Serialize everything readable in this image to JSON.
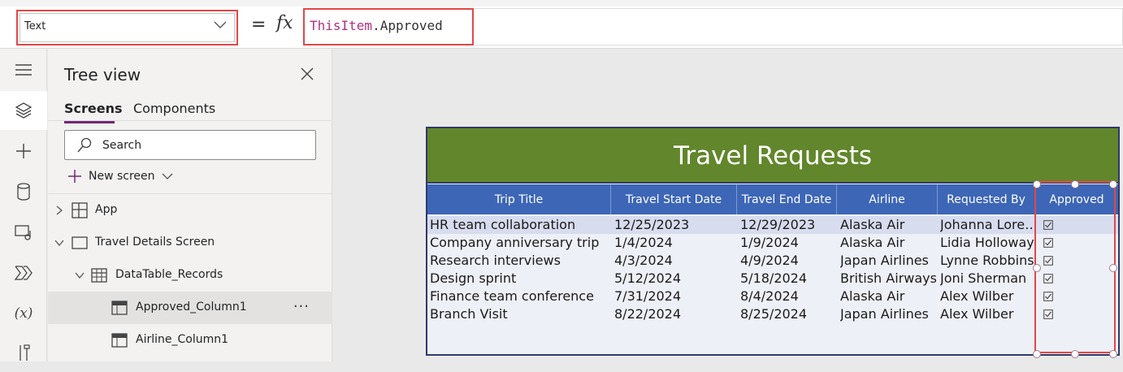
{
  "formula_bar": {
    "property": "Text",
    "equals": "=",
    "fx": "fx",
    "formula_keyword": "ThisItem",
    "formula_rest": ".Approved"
  },
  "rail": {
    "icons": [
      "hamburger-menu-icon",
      "layers-icon",
      "plus-icon",
      "database-icon",
      "media-icon",
      "power-automate-icon",
      "variables-icon",
      "tools-icon"
    ],
    "variables_label": "(x)"
  },
  "tree_view": {
    "title": "Tree view",
    "tabs": [
      "Screens",
      "Components"
    ],
    "search_placeholder": "Search",
    "new_screen_label": "New screen",
    "nodes": [
      {
        "label": "App"
      },
      {
        "label": "Travel Details Screen"
      },
      {
        "label": "DataTable_Records"
      },
      {
        "label": "Approved_Column1",
        "more": "···"
      },
      {
        "label": "Airline_Column1"
      }
    ]
  },
  "canvas": {
    "title": "Travel Requests",
    "columns": [
      "Trip Title",
      "Travel Start Date",
      "Travel End Date",
      "Airline",
      "Requested By",
      "Approved"
    ],
    "rows": [
      [
        "HR team collaboration",
        "12/25/2023",
        "12/29/2023",
        "Alaska Air",
        "Johanna Lore…"
      ],
      [
        "Company anniversary trip",
        "1/4/2024",
        "1/9/2024",
        "Alaska Air",
        "Lidia Holloway"
      ],
      [
        "Research interviews",
        "4/3/2024",
        "4/9/2024",
        "Japan Airlines",
        "Lynne Robbins"
      ],
      [
        "Design sprint",
        "5/12/2024",
        "5/18/2024",
        "British Airways",
        "Joni Sherman"
      ],
      [
        "Finance team conference",
        "7/31/2024",
        "8/4/2024",
        "Alaska Air",
        "Alex Wilber"
      ],
      [
        "Branch Visit",
        "8/22/2024",
        "8/25/2024",
        "Japan Airlines",
        "Alex Wilber"
      ]
    ],
    "approved": [
      true,
      true,
      true,
      true,
      true,
      true
    ]
  },
  "colors": {
    "accent_purple": "#742774",
    "highlight_red": "#e24747",
    "title_green": "#61862b",
    "header_blue": "#3d66b6",
    "formula_keyword": "#b3307f"
  }
}
